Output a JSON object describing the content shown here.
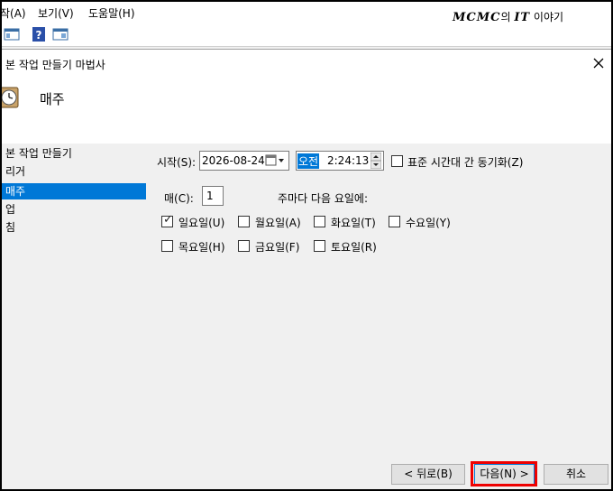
{
  "menubar": {
    "items": [
      "작(A)",
      "보기(V)",
      "도움말(H)"
    ],
    "watermark_bold": "MCMC",
    "watermark_mid": "의 ",
    "watermark_bold2": "IT",
    "watermark_end": " 이야기"
  },
  "toolbar": {
    "icons": [
      "console-tree-icon",
      "help-icon",
      "action-pane-icon"
    ]
  },
  "dialog": {
    "title": "본 작업 만들기 마법사",
    "heading": "매주",
    "nav": [
      "본 작업 만들기",
      "리거",
      "매주",
      "업",
      "침"
    ],
    "selected_nav": "매주",
    "start_label": "시작(S):",
    "start_date": "2026-08-24",
    "time_ampm": "오전",
    "time_value": "2:24:13",
    "sync_timezone_label": "표준 시간대 간 동기화(Z)",
    "sync_timezone_checked": false,
    "every_label": "매(C):",
    "every_value": "1",
    "every_suffix": "주마다 다음 요일에:",
    "days": [
      {
        "label": "일요일(U)",
        "checked": true
      },
      {
        "label": "월요일(A)",
        "checked": false
      },
      {
        "label": "화요일(T)",
        "checked": false
      },
      {
        "label": "수요일(Y)",
        "checked": false
      },
      {
        "label": "목요일(H)",
        "checked": false
      },
      {
        "label": "금요일(F)",
        "checked": false
      },
      {
        "label": "토요일(R)",
        "checked": false
      }
    ],
    "back_button": "< 뒤로(B)",
    "next_button": "다음(N) >",
    "cancel_button": "취소",
    "highlight_color": "#ee0000",
    "selection_color": "#0078d7"
  }
}
